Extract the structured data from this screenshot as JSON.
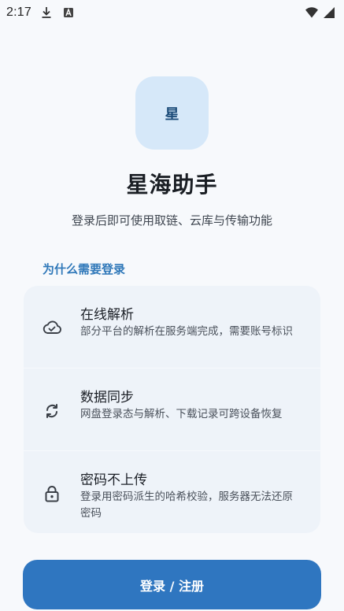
{
  "status_bar": {
    "time": "2:17",
    "icons": [
      "download-icon",
      "keyboard-a-icon",
      "wifi-icon",
      "cellular-signal-icon"
    ]
  },
  "logo": {
    "text": "星",
    "background": "#d6e8f9"
  },
  "app": {
    "title": "星海助手",
    "subtitle": "登录后即可使用取链、云库与传输功能"
  },
  "section": {
    "title": "为什么需要登录"
  },
  "features": [
    {
      "icon": "cloud-check-icon",
      "title": "在线解析",
      "description": "部分平台的解析在服务端完成，需要账号标识"
    },
    {
      "icon": "sync-icon",
      "title": "数据同步",
      "description": "网盘登录态与解析、下载记录可跨设备恢复"
    },
    {
      "icon": "lock-icon",
      "title": "密码不上传",
      "description": "登录用密码派生的哈希校验，服务器无法还原密码"
    }
  ],
  "actions": {
    "login_label": "登录 / 注册"
  },
  "colors": {
    "accent": "#2f76c0",
    "section_title": "#2f78b9",
    "card_background": "#eef3f9",
    "page_background": "#f7f9fc"
  }
}
